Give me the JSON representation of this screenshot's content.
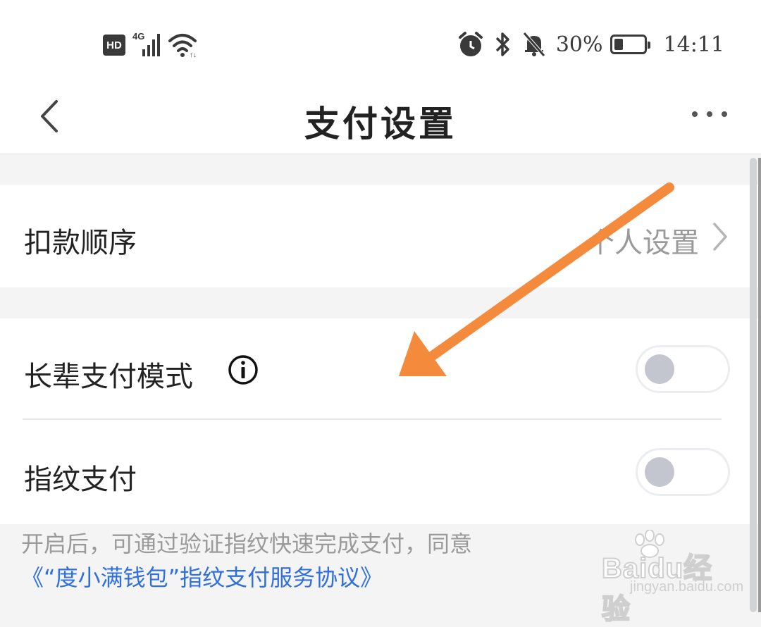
{
  "status_bar": {
    "hd_badge": "HD",
    "network_type": "4G",
    "battery_percent": "30%",
    "battery_level": 0.3,
    "time": "14:11",
    "icons": [
      "signal-icon",
      "wifi-icon",
      "alarm-icon",
      "bluetooth-icon",
      "bell-muted-icon",
      "battery-icon"
    ]
  },
  "header": {
    "title": "支付设置"
  },
  "settings": {
    "deduction_order": {
      "label": "扣款顺序",
      "value": "个人设置"
    },
    "elder_mode": {
      "label": "长辈支付模式",
      "enabled": false
    },
    "fingerprint": {
      "label": "指纹支付",
      "enabled": false
    }
  },
  "footnote": {
    "text": "开启后，可通过验证指纹快速完成支付，同意",
    "link": "《“度小满钱包”指纹支付服务协议》"
  },
  "watermark": {
    "brand": "Baidu经验",
    "url": "jingyan.baidu.com"
  },
  "colors": {
    "accent_link": "#2f6fe0",
    "annotation_arrow": "#f48a3c",
    "toggle_off_knob": "#c3c6cf",
    "background": "#f4f4f5"
  }
}
